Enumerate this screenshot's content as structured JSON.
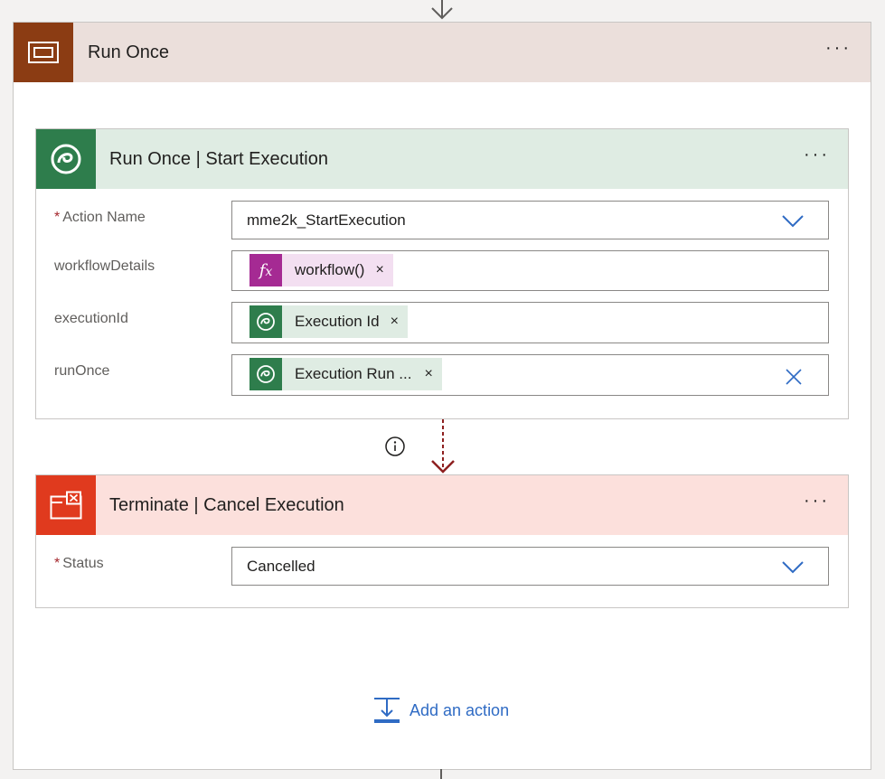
{
  "scope": {
    "title": "Run Once",
    "more_label": "···",
    "header_color": "#ebdfdb",
    "icon_color": "#8b3c13"
  },
  "start_card": {
    "title": "Run Once | Start Execution",
    "more_label": "···",
    "header_color": "#dfece3",
    "icon_color": "#2e7d4c",
    "fields": [
      {
        "label": "Action Name",
        "required": true,
        "value": "mme2k_StartExecution"
      },
      {
        "label": "workflowDetails",
        "required": false,
        "token_label": "workflow()",
        "token_icon": "fx-icon"
      },
      {
        "label": "executionId",
        "required": false,
        "token_label": "Execution Id",
        "token_icon": "dataverse-icon"
      },
      {
        "label": "runOnce",
        "required": false,
        "token_label": "Execution Run ...",
        "token_icon": "dataverse-icon"
      }
    ],
    "required_mark": "*"
  },
  "terminate_card": {
    "title": "Terminate | Cancel Execution",
    "more_label": "···",
    "header_color": "#fce0dc",
    "icon_color": "#e03a1e",
    "fields": [
      {
        "label": "Status",
        "required": true,
        "value": "Cancelled"
      }
    ],
    "required_mark": "*"
  },
  "add_action": {
    "label": "Add an action"
  },
  "token_close": "×",
  "colors": {
    "accent": "#2f6bc4",
    "connector": "#8e2020",
    "fx_token_bg": "#f3dff1",
    "fx_icon": "#a52a93",
    "dataverse_token_bg": "#dfece3",
    "dataverse_icon": "#2e7d4c"
  }
}
